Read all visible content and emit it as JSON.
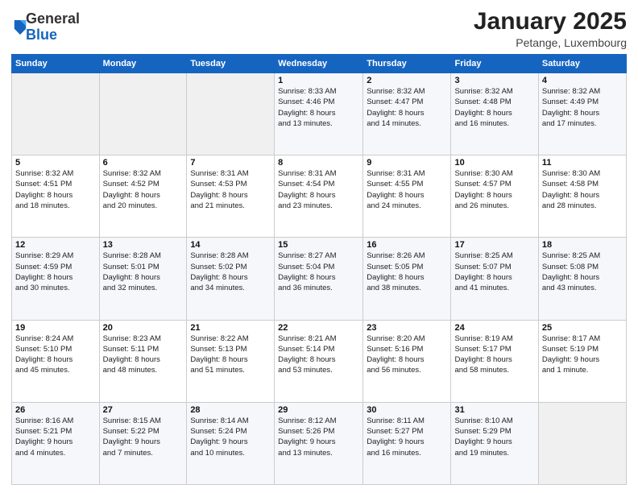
{
  "logo": {
    "general": "General",
    "blue": "Blue"
  },
  "header": {
    "title": "January 2025",
    "location": "Petange, Luxembourg"
  },
  "weekdays": [
    "Sunday",
    "Monday",
    "Tuesday",
    "Wednesday",
    "Thursday",
    "Friday",
    "Saturday"
  ],
  "weeks": [
    [
      {
        "day": "",
        "sunrise": "",
        "sunset": "",
        "daylight": ""
      },
      {
        "day": "",
        "sunrise": "",
        "sunset": "",
        "daylight": ""
      },
      {
        "day": "",
        "sunrise": "",
        "sunset": "",
        "daylight": ""
      },
      {
        "day": "1",
        "sunrise": "Sunrise: 8:33 AM",
        "sunset": "Sunset: 4:46 PM",
        "daylight": "Daylight: 8 hours and 13 minutes."
      },
      {
        "day": "2",
        "sunrise": "Sunrise: 8:32 AM",
        "sunset": "Sunset: 4:47 PM",
        "daylight": "Daylight: 8 hours and 14 minutes."
      },
      {
        "day": "3",
        "sunrise": "Sunrise: 8:32 AM",
        "sunset": "Sunset: 4:48 PM",
        "daylight": "Daylight: 8 hours and 16 minutes."
      },
      {
        "day": "4",
        "sunrise": "Sunrise: 8:32 AM",
        "sunset": "Sunset: 4:49 PM",
        "daylight": "Daylight: 8 hours and 17 minutes."
      }
    ],
    [
      {
        "day": "5",
        "sunrise": "Sunrise: 8:32 AM",
        "sunset": "Sunset: 4:51 PM",
        "daylight": "Daylight: 8 hours and 18 minutes."
      },
      {
        "day": "6",
        "sunrise": "Sunrise: 8:32 AM",
        "sunset": "Sunset: 4:52 PM",
        "daylight": "Daylight: 8 hours and 20 minutes."
      },
      {
        "day": "7",
        "sunrise": "Sunrise: 8:31 AM",
        "sunset": "Sunset: 4:53 PM",
        "daylight": "Daylight: 8 hours and 21 minutes."
      },
      {
        "day": "8",
        "sunrise": "Sunrise: 8:31 AM",
        "sunset": "Sunset: 4:54 PM",
        "daylight": "Daylight: 8 hours and 23 minutes."
      },
      {
        "day": "9",
        "sunrise": "Sunrise: 8:31 AM",
        "sunset": "Sunset: 4:55 PM",
        "daylight": "Daylight: 8 hours and 24 minutes."
      },
      {
        "day": "10",
        "sunrise": "Sunrise: 8:30 AM",
        "sunset": "Sunset: 4:57 PM",
        "daylight": "Daylight: 8 hours and 26 minutes."
      },
      {
        "day": "11",
        "sunrise": "Sunrise: 8:30 AM",
        "sunset": "Sunset: 4:58 PM",
        "daylight": "Daylight: 8 hours and 28 minutes."
      }
    ],
    [
      {
        "day": "12",
        "sunrise": "Sunrise: 8:29 AM",
        "sunset": "Sunset: 4:59 PM",
        "daylight": "Daylight: 8 hours and 30 minutes."
      },
      {
        "day": "13",
        "sunrise": "Sunrise: 8:28 AM",
        "sunset": "Sunset: 5:01 PM",
        "daylight": "Daylight: 8 hours and 32 minutes."
      },
      {
        "day": "14",
        "sunrise": "Sunrise: 8:28 AM",
        "sunset": "Sunset: 5:02 PM",
        "daylight": "Daylight: 8 hours and 34 minutes."
      },
      {
        "day": "15",
        "sunrise": "Sunrise: 8:27 AM",
        "sunset": "Sunset: 5:04 PM",
        "daylight": "Daylight: 8 hours and 36 minutes."
      },
      {
        "day": "16",
        "sunrise": "Sunrise: 8:26 AM",
        "sunset": "Sunset: 5:05 PM",
        "daylight": "Daylight: 8 hours and 38 minutes."
      },
      {
        "day": "17",
        "sunrise": "Sunrise: 8:25 AM",
        "sunset": "Sunset: 5:07 PM",
        "daylight": "Daylight: 8 hours and 41 minutes."
      },
      {
        "day": "18",
        "sunrise": "Sunrise: 8:25 AM",
        "sunset": "Sunset: 5:08 PM",
        "daylight": "Daylight: 8 hours and 43 minutes."
      }
    ],
    [
      {
        "day": "19",
        "sunrise": "Sunrise: 8:24 AM",
        "sunset": "Sunset: 5:10 PM",
        "daylight": "Daylight: 8 hours and 45 minutes."
      },
      {
        "day": "20",
        "sunrise": "Sunrise: 8:23 AM",
        "sunset": "Sunset: 5:11 PM",
        "daylight": "Daylight: 8 hours and 48 minutes."
      },
      {
        "day": "21",
        "sunrise": "Sunrise: 8:22 AM",
        "sunset": "Sunset: 5:13 PM",
        "daylight": "Daylight: 8 hours and 51 minutes."
      },
      {
        "day": "22",
        "sunrise": "Sunrise: 8:21 AM",
        "sunset": "Sunset: 5:14 PM",
        "daylight": "Daylight: 8 hours and 53 minutes."
      },
      {
        "day": "23",
        "sunrise": "Sunrise: 8:20 AM",
        "sunset": "Sunset: 5:16 PM",
        "daylight": "Daylight: 8 hours and 56 minutes."
      },
      {
        "day": "24",
        "sunrise": "Sunrise: 8:19 AM",
        "sunset": "Sunset: 5:17 PM",
        "daylight": "Daylight: 8 hours and 58 minutes."
      },
      {
        "day": "25",
        "sunrise": "Sunrise: 8:17 AM",
        "sunset": "Sunset: 5:19 PM",
        "daylight": "Daylight: 9 hours and 1 minute."
      }
    ],
    [
      {
        "day": "26",
        "sunrise": "Sunrise: 8:16 AM",
        "sunset": "Sunset: 5:21 PM",
        "daylight": "Daylight: 9 hours and 4 minutes."
      },
      {
        "day": "27",
        "sunrise": "Sunrise: 8:15 AM",
        "sunset": "Sunset: 5:22 PM",
        "daylight": "Daylight: 9 hours and 7 minutes."
      },
      {
        "day": "28",
        "sunrise": "Sunrise: 8:14 AM",
        "sunset": "Sunset: 5:24 PM",
        "daylight": "Daylight: 9 hours and 10 minutes."
      },
      {
        "day": "29",
        "sunrise": "Sunrise: 8:12 AM",
        "sunset": "Sunset: 5:26 PM",
        "daylight": "Daylight: 9 hours and 13 minutes."
      },
      {
        "day": "30",
        "sunrise": "Sunrise: 8:11 AM",
        "sunset": "Sunset: 5:27 PM",
        "daylight": "Daylight: 9 hours and 16 minutes."
      },
      {
        "day": "31",
        "sunrise": "Sunrise: 8:10 AM",
        "sunset": "Sunset: 5:29 PM",
        "daylight": "Daylight: 9 hours and 19 minutes."
      },
      {
        "day": "",
        "sunrise": "",
        "sunset": "",
        "daylight": ""
      }
    ]
  ]
}
